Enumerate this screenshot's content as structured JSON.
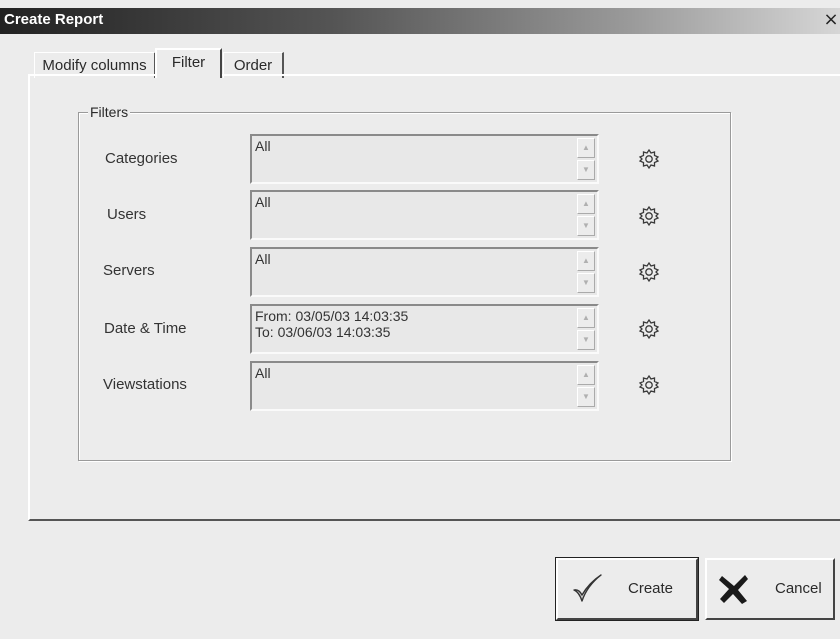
{
  "window": {
    "title": "Create Report",
    "close_glyph": "×"
  },
  "tabs": [
    {
      "label": "Modify columns"
    },
    {
      "label": "Filter"
    },
    {
      "label": "Order"
    }
  ],
  "filters_group": {
    "label": "Filters",
    "rows": [
      {
        "label": "Categories",
        "lines": [
          "All",
          ""
        ]
      },
      {
        "label": "Users",
        "lines": [
          "All",
          ""
        ]
      },
      {
        "label": "Servers",
        "lines": [
          "All",
          ""
        ]
      },
      {
        "label": "Date & Time",
        "lines": [
          "From: 03/05/03 14:03:35",
          "To: 03/06/03 14:03:35"
        ]
      },
      {
        "label": "Viewstations",
        "lines": [
          "All",
          ""
        ]
      }
    ]
  },
  "buttons": {
    "create": {
      "label": "Create",
      "icon": "checkmark-icon"
    },
    "cancel": {
      "label": "Cancel",
      "icon": "x-mark-icon"
    }
  },
  "icons": {
    "filter_settings": "gear-icon",
    "scroll_up": "▲",
    "scroll_down": "▼"
  }
}
